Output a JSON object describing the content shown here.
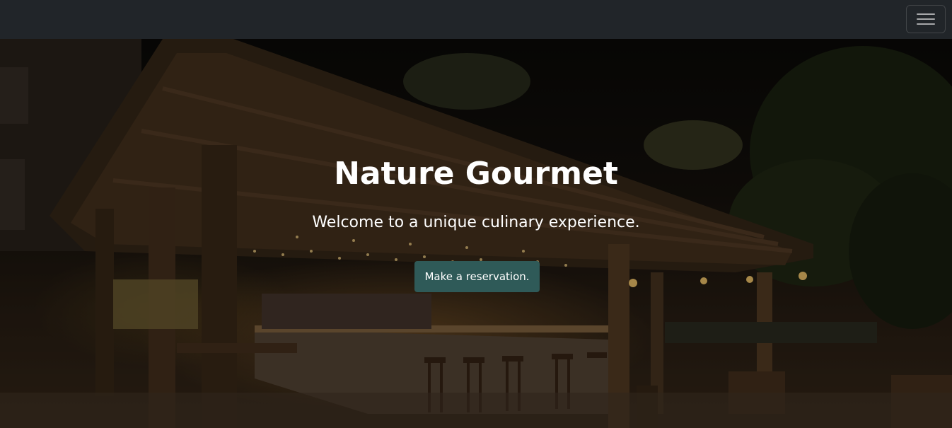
{
  "navbar": {
    "toggler_icon": "hamburger-menu-icon"
  },
  "hero": {
    "title": "Nature Gourmet",
    "subtitle": "Welcome to a unique culinary experience.",
    "cta_label": "Make a reservation.",
    "background": "outdoor-bar-at-night-photo"
  },
  "colors": {
    "navbar_bg": "#212529",
    "cta_bg": "#2f5a58",
    "text": "#ffffff"
  }
}
